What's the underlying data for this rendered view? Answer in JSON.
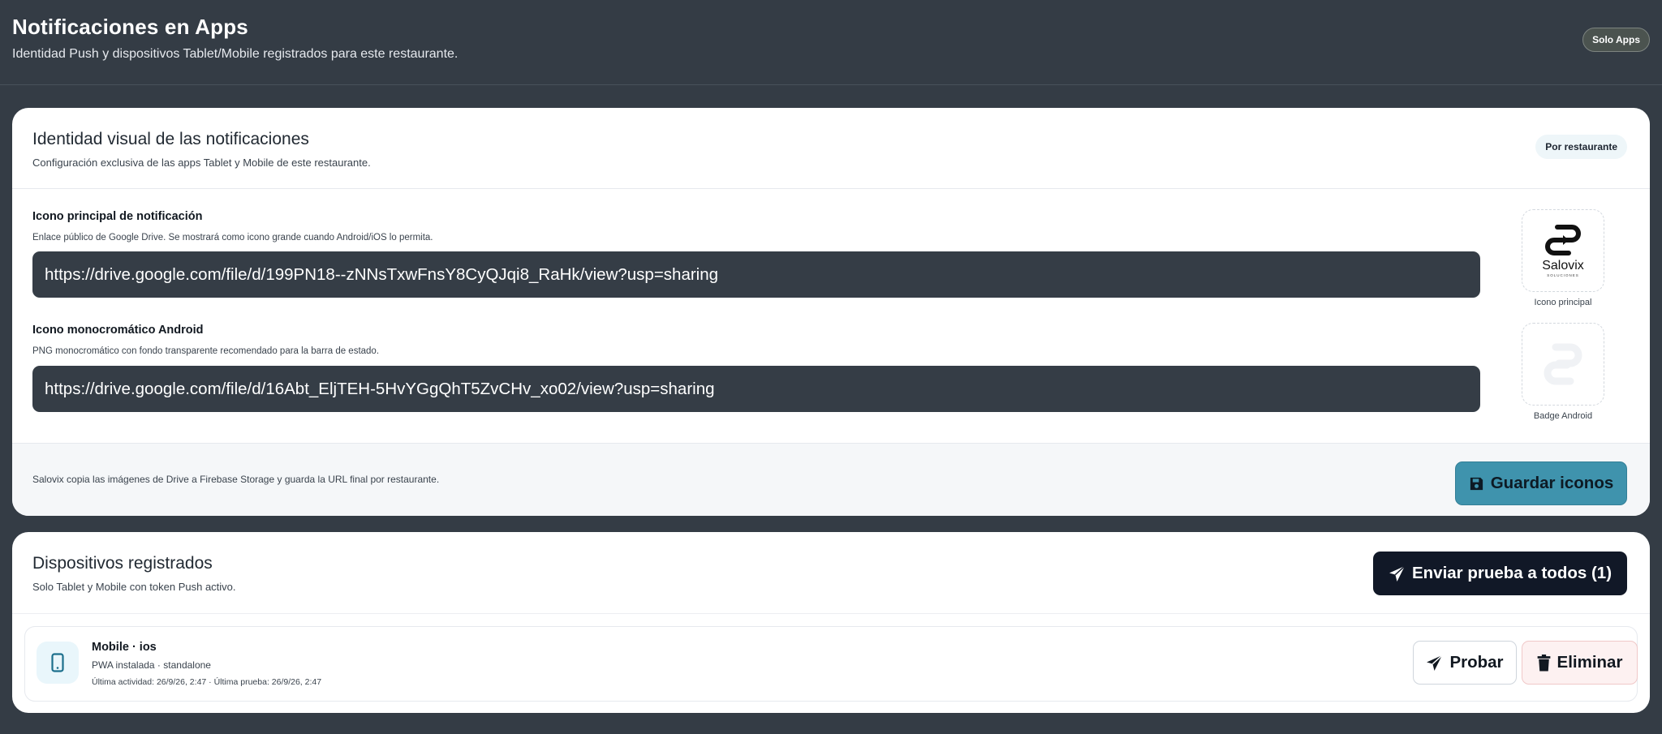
{
  "header": {
    "title": "Notificaciones en Apps",
    "subtitle": "Identidad Push y dispositivos Tablet/Mobile registrados para este restaurante.",
    "badge": "Solo Apps"
  },
  "identity_card": {
    "title": "Identidad visual de las notificaciones",
    "description": "Configuración exclusiva de las apps Tablet y Mobile de este restaurante.",
    "chip": "Por restaurante",
    "main_icon": {
      "label": "Icono principal de notificación",
      "help": "Enlace público de Google Drive. Se mostrará como icono grande cuando Android/iOS lo permita.",
      "value": "https://drive.google.com/file/d/199PN18--zNNsTxwFnsY8CyQJqi8_RaHk/view?usp=sharing",
      "preview_caption": "Icono principal",
      "preview_brand": "Salovix",
      "preview_tagline": "SOLUCIONES"
    },
    "mono_icon": {
      "label": "Icono monocromático Android",
      "help": "PNG monocromático con fondo transparente recomendado para la barra de estado.",
      "value": "https://drive.google.com/file/d/16Abt_EljTEH-5HvYGgQhT5ZvCHv_xo02/view?usp=sharing",
      "preview_caption": "Badge Android"
    },
    "footer_note": "Salovix copia las imágenes de Drive a Firebase Storage y guarda la URL final por restaurante.",
    "save_button": "Guardar iconos",
    "save_icon": "floppy-disk-icon",
    "accent_color": "#3f93ad"
  },
  "devices_card": {
    "title": "Dispositivos registrados",
    "description": "Solo Tablet y Mobile con token Push activo.",
    "send_all_button": "Enviar prueba a todos (1)",
    "send_icon": "paper-plane-icon",
    "devices": [
      {
        "name": "Mobile · ios",
        "status": "PWA instalada · standalone",
        "activity": "Última actividad: 26/9/26, 2:47 · Última prueba: 26/9/26, 2:47",
        "icon": "mobile-phone-icon",
        "test_button": "Probar",
        "delete_button": "Eliminar"
      }
    ]
  }
}
